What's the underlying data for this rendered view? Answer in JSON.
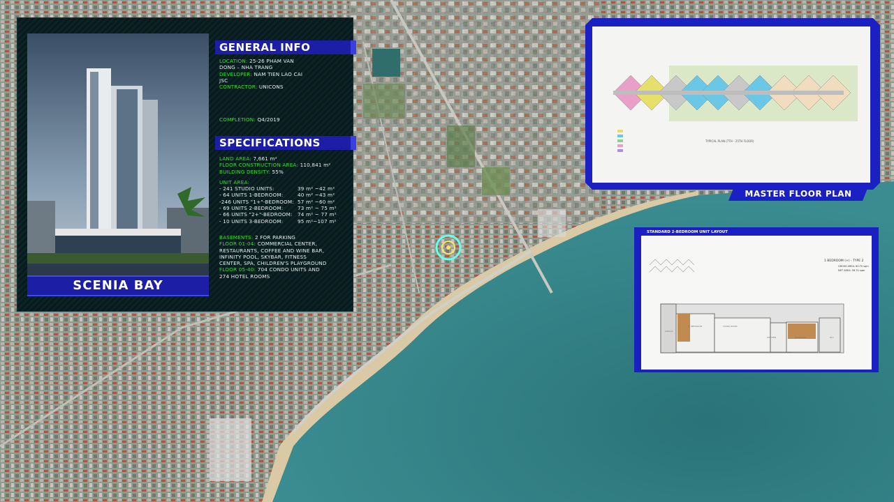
{
  "project": {
    "name": "SCENIA BAY"
  },
  "general": {
    "title": "GENERAL INFO",
    "location_label": "LOCATION:",
    "location_value_1": "25-26 PHAM VAN",
    "location_value_2": "DONG – NHA TRANG",
    "developer_label": "DEVELOPER:",
    "developer_value_1": "NAM TIEN LAO CAI",
    "developer_value_2": "JSC",
    "contractor_label": "CONTRACTOR:",
    "contractor_value": "UNICONS",
    "completion_label": "COMPLETION:",
    "completion_value": "Q4/2019"
  },
  "specs": {
    "title": "SPECIFICATIONS",
    "land_label": "LAND AREA:",
    "land_value": "7,661 m²",
    "floor_label": "FLOOR CONSTRUCTION AREA:",
    "floor_value": "110,841 m²",
    "density_label": "BUILDING DENSITY:",
    "density_value": "55%",
    "unit_area_label": "UNIT AREA:",
    "units": [
      {
        "name": "- 241 STUDIO UNITS:",
        "area": "39 m² ~42 m²"
      },
      {
        "name": "- 64 UNITS 1-BEDROOM:",
        "area": "40 m² ~43 m²"
      },
      {
        "name": "-246 UNITS \"1+\"-BEDROOM:",
        "area": "57 m² ~60 m²"
      },
      {
        "name": "- 69 UNITS 2-BEDROOM:",
        "area": "73 m² ~ 75 m²"
      },
      {
        "name": "- 66 UNITS \"2+\"-BEDROOM:",
        "area": "74 m² ~ 77 m²"
      },
      {
        "name": "- 10 UNITS 3-BEDROOM:",
        "area": "95 m²~107 m²"
      }
    ],
    "basements_label": "BASEMENTS:",
    "basements_value": "2 FOR PARKING",
    "floor0104_label": "FLOOR 01-04:",
    "floor0104_value_1": "COMMERCIAL CENTER,",
    "floor0104_value_2": "RESTAURANTS, COFFEE AND WINE BAR,",
    "floor0104_value_3": "INFINITY POOL, SKYBAR, FITNESS",
    "floor0104_value_4": "CENTER, SPA, CHILDREN'S PLAYGROUND",
    "floor0540_label": "FLOOR 05-40:",
    "floor0540_value_1": "704 CONDO UNITS AND",
    "floor0540_value_2": "274 HOTEL ROOMS"
  },
  "floorplan": {
    "caption": "MASTER FLOOR PLAN",
    "typical": "TYPICAL PLAN (7TH - 25TH FLOOR)"
  },
  "unit_layout": {
    "header": "STANDARD 2-BEDROOM UNIT LAYOUT",
    "type": "1 BEDROOM (+) - TYPE 2",
    "gross": "GROSS AREA: 60.70 sqm",
    "net": "NET AREA: 56.70 sqm",
    "rooms": [
      "LOGGIA",
      "M. BEDROOM",
      "LIVING ROOM",
      "KITCHEN",
      "BEDROOM",
      "W.C"
    ]
  },
  "colors": {
    "panel_blue": "#1c1fa6",
    "label_green": "#31e231",
    "sea": "#2f7d83"
  },
  "icons": {
    "map_marker": "location-ring-icon"
  }
}
